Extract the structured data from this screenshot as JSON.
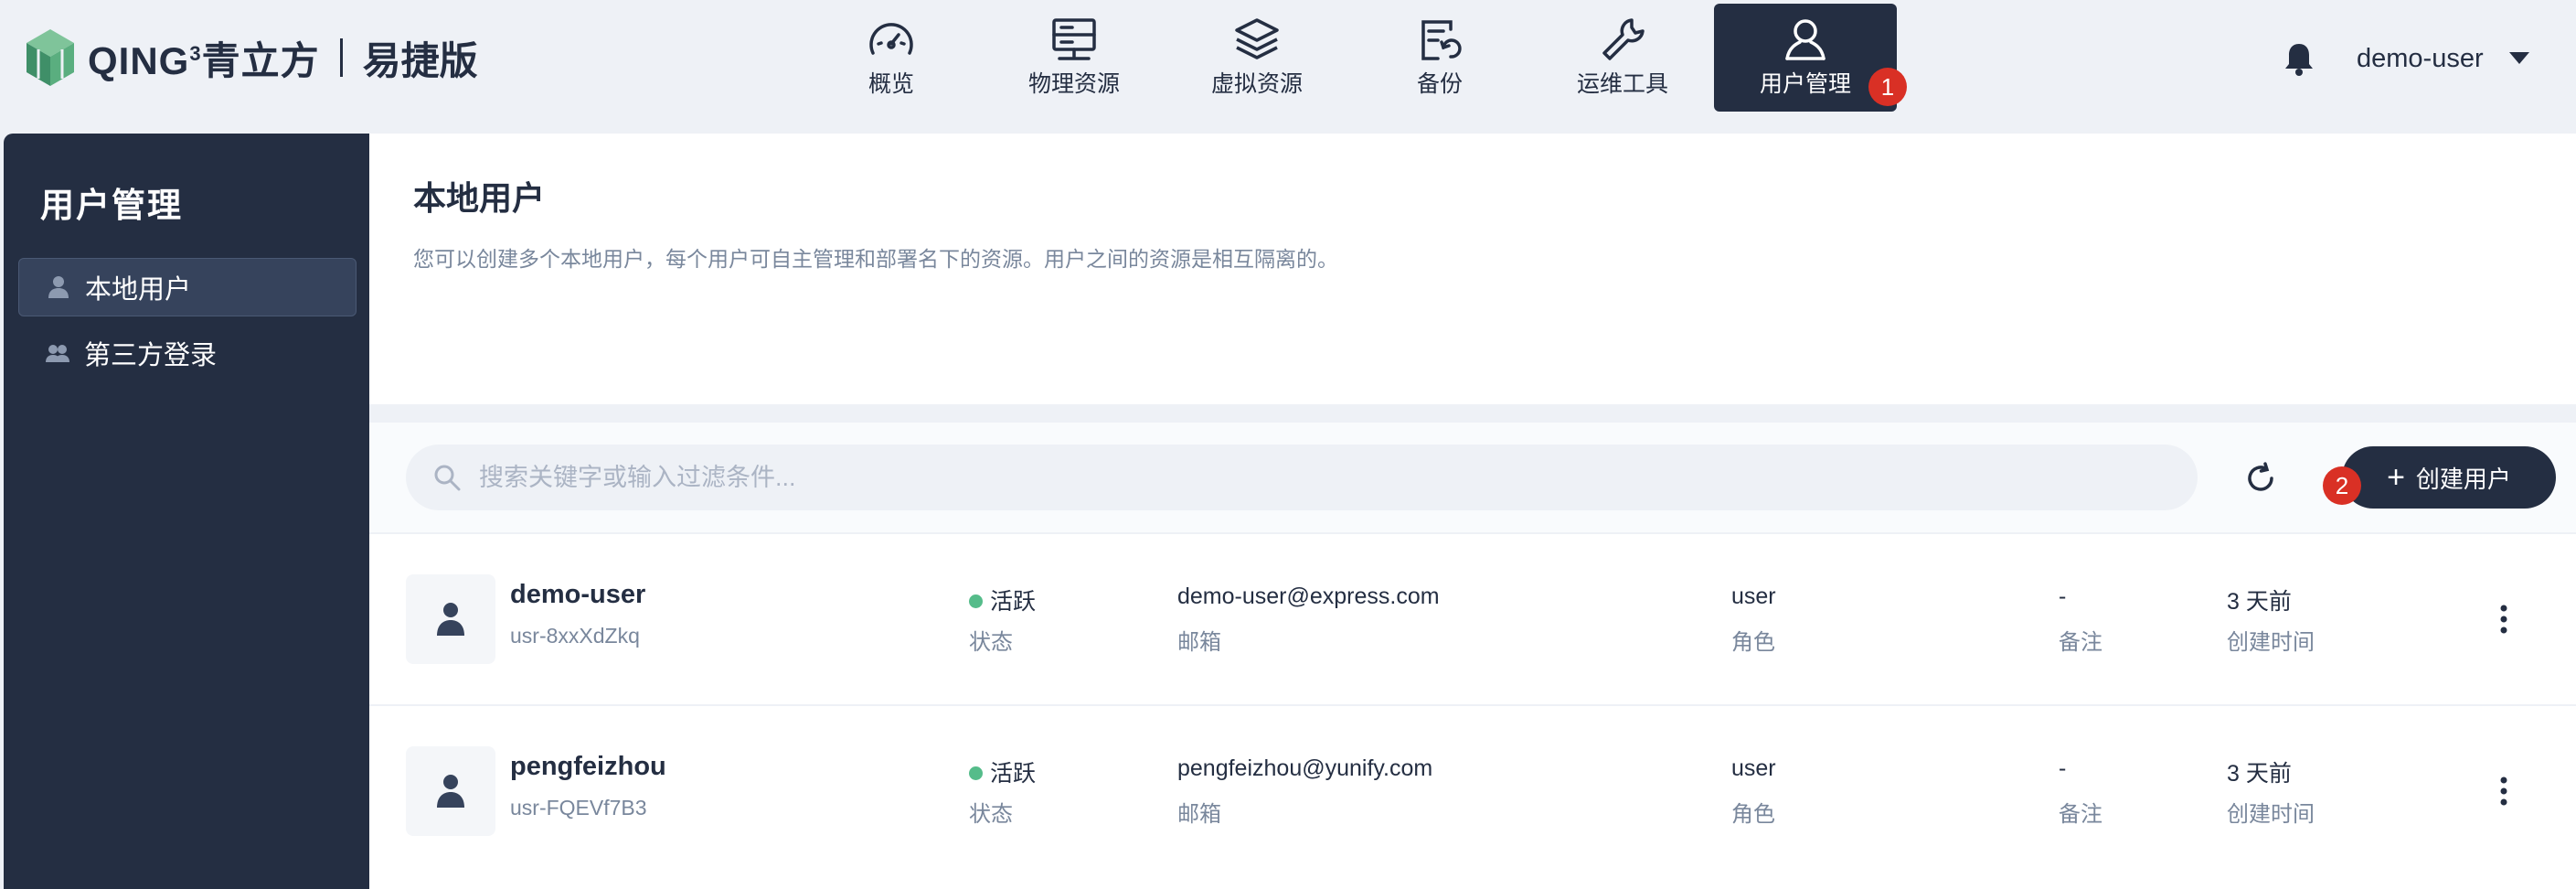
{
  "logo": {
    "brand": "QING",
    "sup": "3",
    "brand_cn": "青立方",
    "edition": "易捷版"
  },
  "nav": [
    {
      "label": "概览",
      "icon": "dashboard-icon"
    },
    {
      "label": "物理资源",
      "icon": "server-icon"
    },
    {
      "label": "虚拟资源",
      "icon": "layers-icon"
    },
    {
      "label": "备份",
      "icon": "backup-icon"
    },
    {
      "label": "运维工具",
      "icon": "wrench-icon"
    },
    {
      "label": "用户管理",
      "icon": "user-icon",
      "active": true
    }
  ],
  "badges": {
    "first": "1",
    "second": "2"
  },
  "header_user": {
    "name": "demo-user"
  },
  "sidebar": {
    "title": "用户管理",
    "items": [
      {
        "label": "本地用户",
        "icon": "user-icon",
        "active": true
      },
      {
        "label": "第三方登录",
        "icon": "users-icon"
      }
    ]
  },
  "page": {
    "title": "本地用户",
    "description": "您可以创建多个本地用户，每个用户可自主管理和部署名下的资源。用户之间的资源是相互隔离的。"
  },
  "toolbar": {
    "search_placeholder": "搜索关键字或输入过滤条件...",
    "create_label": "创建用户",
    "create_plus": "+"
  },
  "users": [
    {
      "name": "demo-user",
      "id": "usr-8xxXdZkq",
      "status": "活跃",
      "status_key": "状态",
      "email": "demo-user@express.com",
      "email_key": "邮箱",
      "role": "user",
      "role_key": "角色",
      "note": "-",
      "note_key": "备注",
      "created": "3 天前",
      "created_key": "创建时间"
    },
    {
      "name": "pengfeizhou",
      "id": "usr-FQEVf7B3",
      "status": "活跃",
      "status_key": "状态",
      "email": "pengfeizhou@yunify.com",
      "email_key": "邮箱",
      "role": "user",
      "role_key": "角色",
      "note": "-",
      "note_key": "备注",
      "created": "3 天前",
      "created_key": "创建时间"
    }
  ],
  "colors": {
    "primary_dark": "#242e42",
    "background": "#eef1f6",
    "active_status": "#55bc8a",
    "badge": "#d93025",
    "muted_text": "#79879c"
  }
}
